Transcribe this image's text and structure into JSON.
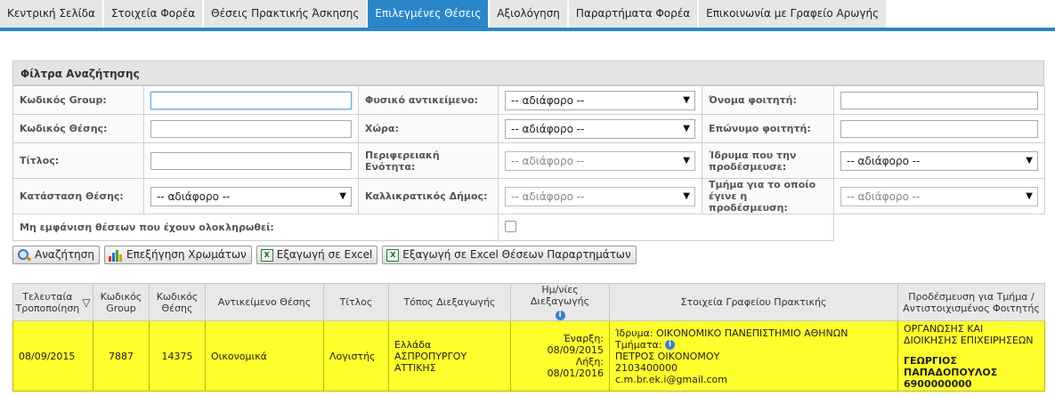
{
  "tabs": [
    {
      "label": "Κεντρική Σελίδα",
      "active": false
    },
    {
      "label": "Στοιχεία Φορέα",
      "active": false
    },
    {
      "label": "Θέσεις Πρακτικής Άσκησης",
      "active": false
    },
    {
      "label": "Επιλεγμένες Θέσεις",
      "active": true
    },
    {
      "label": "Αξιολόγηση",
      "active": false
    },
    {
      "label": "Παραρτήματα Φορέα",
      "active": false
    },
    {
      "label": "Επικοινωνία με Γραφείο Αρωγής",
      "active": false
    }
  ],
  "filters": {
    "title": "Φίλτρα Αναζήτησης",
    "group_code_label": "Κωδικός Group:",
    "group_code_value": "",
    "position_code_label": "Κωδικός Θέσης:",
    "position_code_value": "",
    "title_label": "Τίτλος:",
    "title_value": "",
    "position_status_label": "Κατάσταση Θέσης:",
    "position_status_value": "-- αδιάφορο --",
    "physical_object_label": "Φυσικό αντικείμενο:",
    "physical_object_value": "-- αδιάφορο --",
    "country_label": "Χώρα:",
    "country_value": "-- αδιάφορο --",
    "regional_unit_label": "Περιφερειακή Ενότητα:",
    "regional_unit_value": "-- αδιάφορο --",
    "municipality_label": "Καλλικρατικός Δήμος:",
    "municipality_value": "-- αδιάφορο --",
    "student_first_name_label": "Όνομα φοιτητή:",
    "student_first_name_value": "",
    "student_last_name_label": "Επώνυμο φοιτητή:",
    "student_last_name_value": "",
    "institution_label": "Ίδρυμα που την προδέσμευσε:",
    "institution_value": "-- αδιάφορο --",
    "department_label": "Τμήμα για το οποίο έγινε η προδέσμευση:",
    "department_value": "-- αδιάφορο --",
    "hide_completed_label": "Μη εμφάνιση θέσεων που έχουν ολοκληρωθεί:",
    "hide_completed_checked": false
  },
  "actions": {
    "search": "Αναζήτηση",
    "color_legend": "Επεξήγηση Χρωμάτων",
    "export_excel": "Εξαγωγή σε Excel",
    "export_excel_annex": "Εξαγωγή σε Excel Θέσεων Παραρτημάτων"
  },
  "grid": {
    "headers": {
      "last_modified": "Τελευταία Τροποποίηση",
      "group_code": "Κωδικός Group",
      "position_code": "Κωδικός Θέσης",
      "subject": "Αντικείμενο Θέσης",
      "title": "Τίτλος",
      "location": "Τόπος Διεξαγωγής",
      "dates": "Ημ/νίες Διεξαγωγής",
      "office_info": "Στοιχεία Γραφείου Πρακτικής",
      "reservation": "Προδέσμευση για Τμήμα / Αντιστοιχισμένος Φοιτητής"
    },
    "row_highlight_color": "#ffff2e",
    "rows": [
      {
        "last_modified": "08/09/2015",
        "group_code": "7887",
        "position_code": "14375",
        "subject": "Οικονομικά",
        "title": "Λογιστής",
        "location_country": "Ελλάδα",
        "location_city": "ΑΣΠΡΟΠΥΡΓΟΥ",
        "location_region": "ΑΤΤΙΚΗΣ",
        "start_date": "Έναρξη: 08/09/2015",
        "end_date": "Λήξη: 08/01/2016",
        "institution": "Ίδρυμα: ΟΙΚΟΝΟΜΙΚΟ ΠΑΝΕΠΙΣΤΗΜΙΟ ΑΘΗΝΩΝ",
        "departments_label": "Τμήματα:",
        "contact_name": "ΠΕΤΡΟΣ ΟΙΚΟΝΟΜΟΥ",
        "contact_phone": "2103400000",
        "contact_email": "c.m.br.ek.i@gmail.com",
        "reserved_department": "ΟΡΓΑΝΩΣΗΣ ΚΑΙ ΔΙΟΙΚΗΣΗΣ ΕΠΙΧΕΙΡΗΣΕΩΝ",
        "student_name": "ΓΕΩΡΓΙΟΣ ΠΑΠΑΔΟΠΟΥΛΟΣ",
        "student_phone": "6900000000"
      }
    ]
  },
  "icons": {
    "sort": "▽",
    "select_arrow": "▼",
    "info": "i"
  }
}
